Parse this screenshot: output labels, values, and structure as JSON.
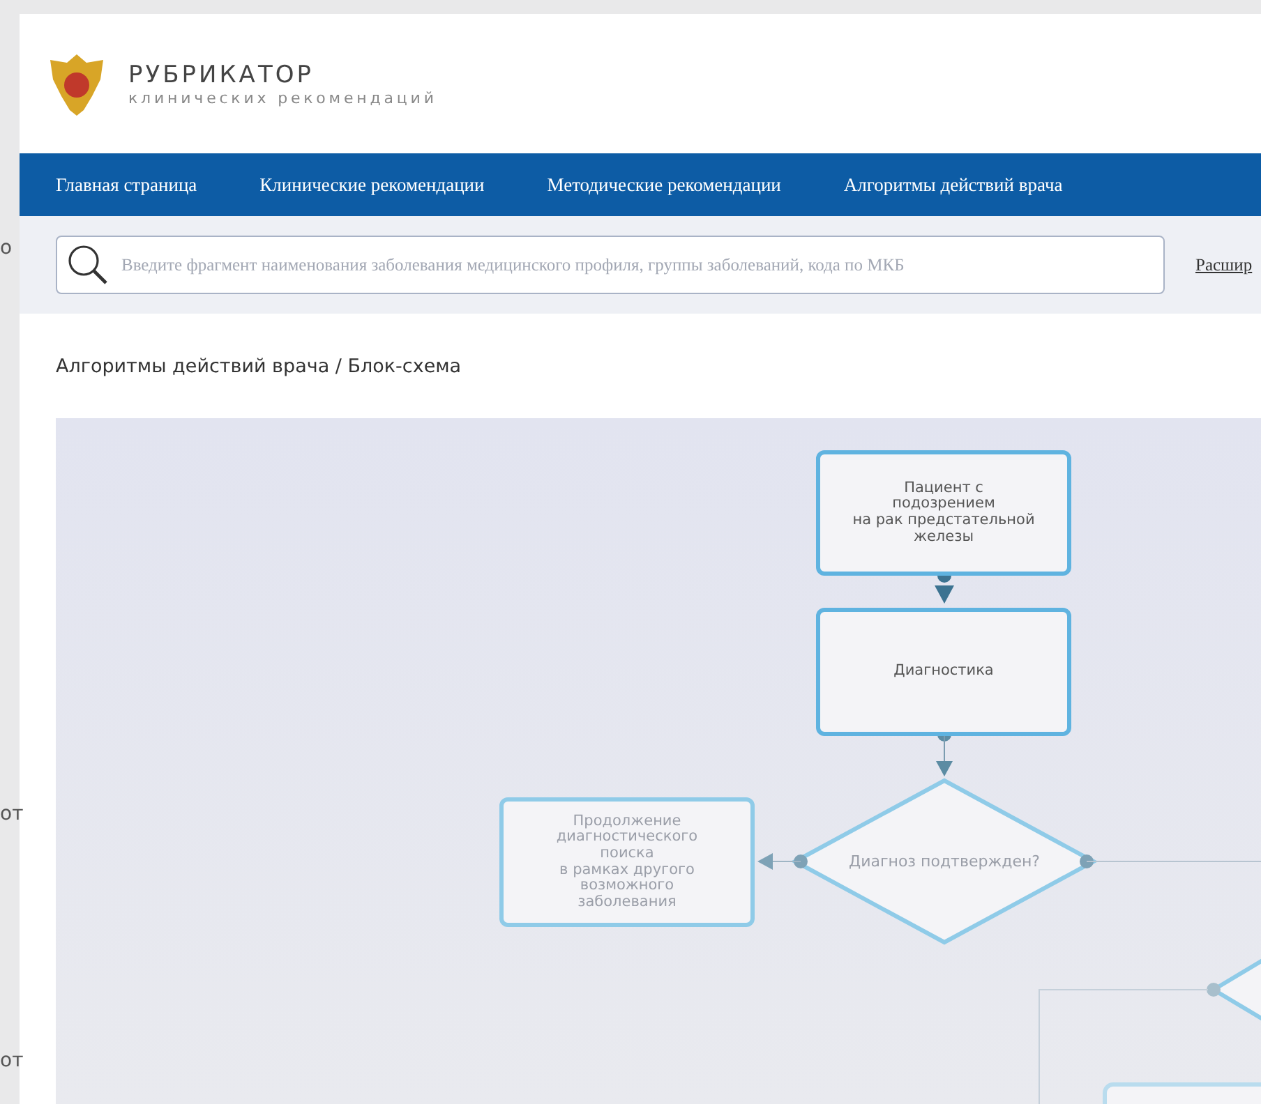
{
  "background_fragments": [
    "о",
    "от",
    "от"
  ],
  "logo": {
    "title": "РУБРИКАТОР",
    "subtitle": "клинических рекомендаций"
  },
  "nav": [
    {
      "label": "Главная страница"
    },
    {
      "label": "Клинические рекомендации"
    },
    {
      "label": "Методические рекомендации"
    },
    {
      "label": "Алгоритмы действий врача"
    }
  ],
  "search": {
    "placeholder": "Введите фрагмент наименования заболевания медицинского профиля, группы заболеваний, кода по МКБ",
    "link": "Расшир"
  },
  "breadcrumb": "Алгоритмы действий врача / Блок-схема",
  "flowchart": {
    "nodes": [
      {
        "kind": "process",
        "text": "Пациент с\nподозрением\nна рак предстательной\nжелезы",
        "dimmed": false
      },
      {
        "kind": "process",
        "text": "Диагностика",
        "dimmed": false
      },
      {
        "kind": "process",
        "text": "Продолжение\nдиагностического\nпоиска\nв рамках другого\nвозможного\nзаболевания",
        "dimmed": true
      },
      {
        "kind": "decision",
        "text": "Диагноз подтвержден?",
        "dimmed": true
      }
    ]
  }
}
